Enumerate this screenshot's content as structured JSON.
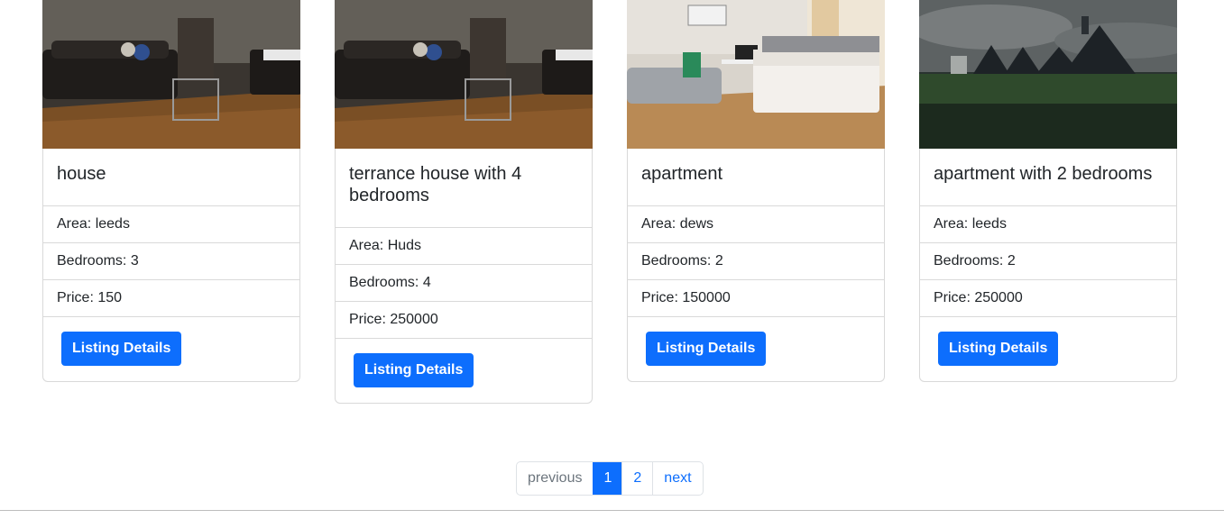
{
  "listings": [
    {
      "title": "house",
      "area": "Area: leeds",
      "bedrooms": "Bedrooms: 3",
      "price": "Price: 150",
      "button": "Listing Details"
    },
    {
      "title": "terrance house with 4 bedrooms",
      "area": "Area: Huds",
      "bedrooms": "Bedrooms: 4",
      "price": "Price: 250000",
      "button": "Listing Details"
    },
    {
      "title": "apartment",
      "area": "Area: dews",
      "bedrooms": "Bedrooms: 2",
      "price": "Price: 150000",
      "button": "Listing Details"
    },
    {
      "title": "apartment with 2 bedrooms",
      "area": "Area: leeds",
      "bedrooms": "Bedrooms: 2",
      "price": "Price: 250000",
      "button": "Listing Details"
    }
  ],
  "pagination": {
    "previous": "previous",
    "pages": [
      "1",
      "2"
    ],
    "current": "1",
    "next": "next"
  },
  "colors": {
    "primary": "#0d6efd",
    "border": "#d9d9d9",
    "muted": "#6c757d"
  }
}
